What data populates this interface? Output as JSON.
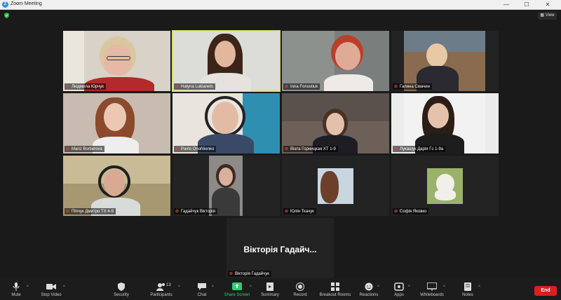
{
  "window": {
    "title": "Zoom Meeting",
    "minimize": "—",
    "maximize": "☐",
    "close": "✕"
  },
  "view": {
    "label": "View"
  },
  "participants": [
    {
      "name": "Людмила Юрчук"
    },
    {
      "name": "Halyna Lukianets"
    },
    {
      "name": "Inna Fonostiuk"
    },
    {
      "name": "Галина Смачин"
    },
    {
      "name": "Mariz Bortierova"
    },
    {
      "name": "Pavlo Onofriienko"
    },
    {
      "name": "Віата Горницкая ХТ 1-9"
    },
    {
      "name": "Лукашук Дарія Гс 1-9а"
    },
    {
      "name": "Піпчук Дмитро ТХ 4-9"
    },
    {
      "name": "Гадайчук Вікторія"
    },
    {
      "name": "Юлія Ткачук"
    },
    {
      "name": "Софія Яковко"
    },
    {
      "name": "Вікторія Гадайчук",
      "display": "Вікторія Гадайч..."
    }
  ],
  "toolbar": {
    "mute": "Mute",
    "stop_video": "Stop Video",
    "security": "Security",
    "participants": "Participants",
    "participants_count": "13",
    "chat": "Chat",
    "share_screen": "Share Screen",
    "summary": "Summary",
    "record": "Record",
    "breakout_rooms": "Breakout Rooms",
    "reactions": "Reactions",
    "apps": "Apps",
    "whiteboards": "Whiteboards",
    "notes": "Notes",
    "end": "End"
  },
  "colors": {
    "active_speaker": "#d7e27a",
    "end": "#d9201f",
    "share": "#2ecc71",
    "muted": "#e0463e"
  }
}
